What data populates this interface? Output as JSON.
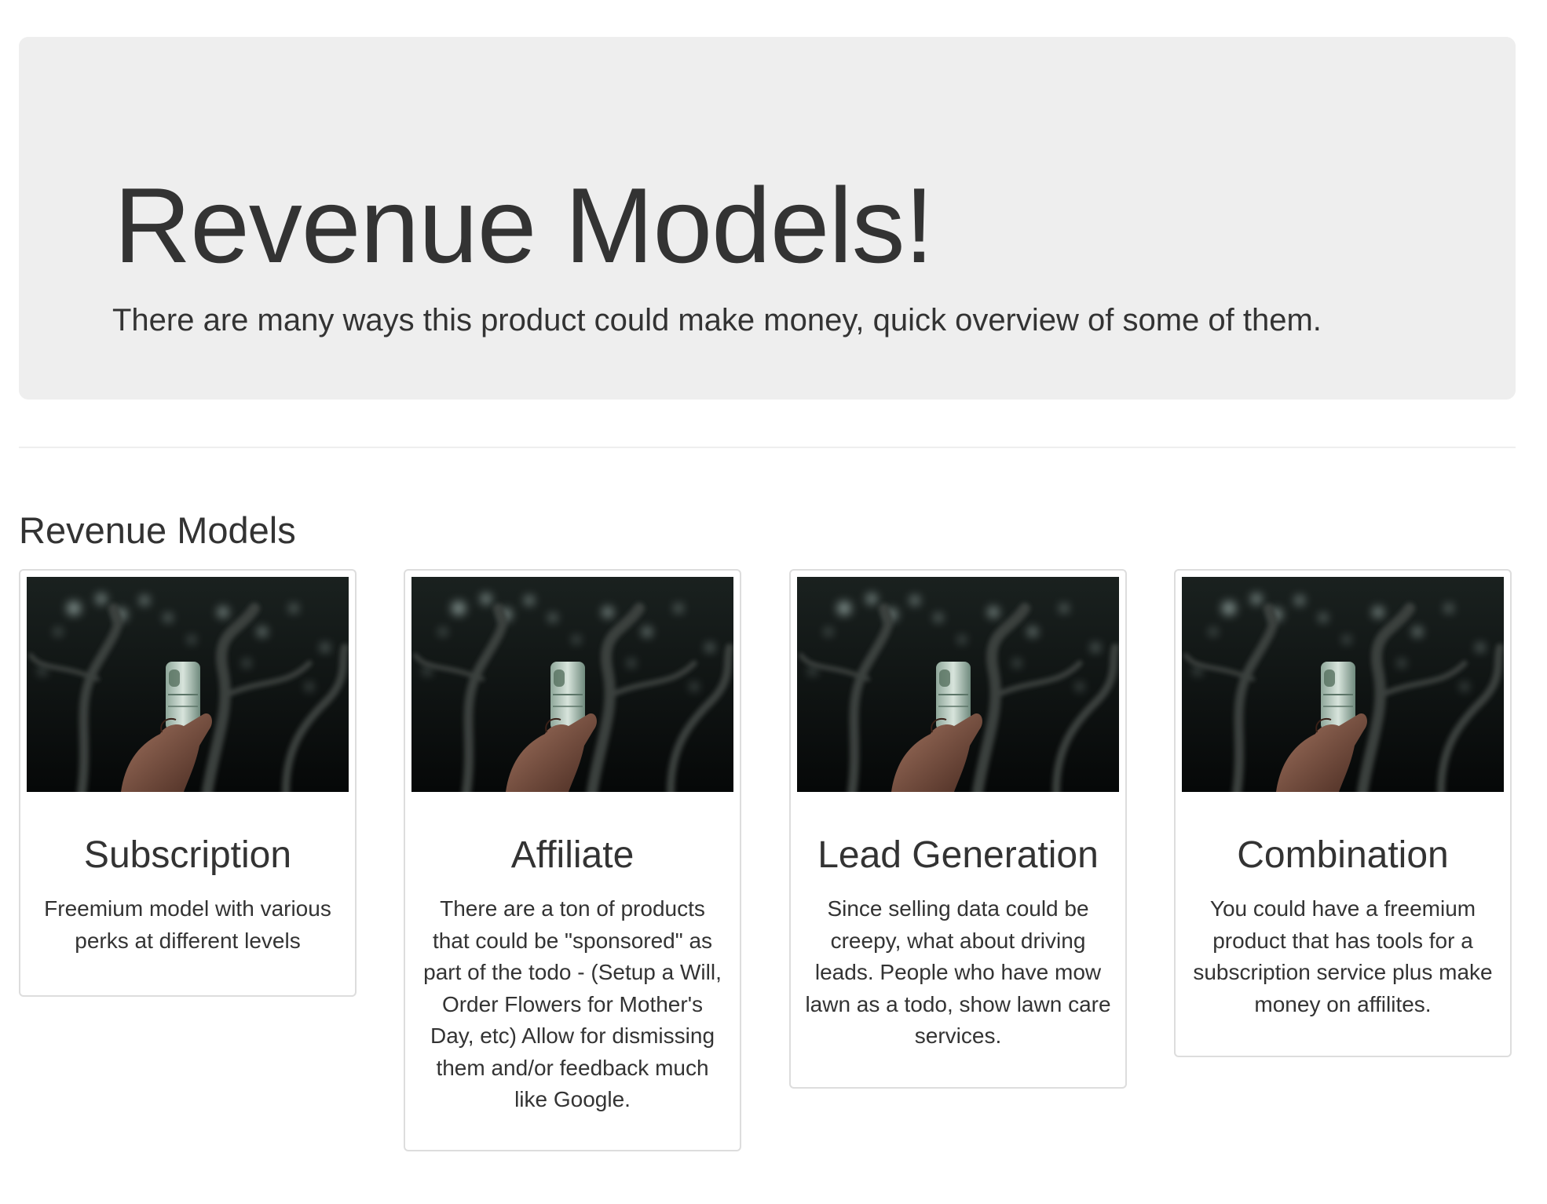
{
  "hero": {
    "title": "Revenue Models!",
    "subtitle": "There are many ways this product could make money, quick overview of some of them."
  },
  "section": {
    "title": "Revenue Models"
  },
  "cards": [
    {
      "title": "Subscription",
      "text": "Freemium model with various perks at different levels",
      "image": "money-photo"
    },
    {
      "title": "Affiliate",
      "text": "There are a ton of products that could be \"sponsored\" as part of the todo - (Setup a Will, Order Flowers for Mother's Day, etc) Allow for dismissing them and/or feedback much like Google.",
      "image": "money-photo"
    },
    {
      "title": "Lead Generation",
      "text": "Since selling data could be creepy, what about driving leads. People who have mow lawn as a todo, show lawn care services.",
      "image": "money-photo"
    },
    {
      "title": "Combination",
      "text": "You could have a freemium product that has tools for a subscription service plus make money on affilites.",
      "image": "money-photo"
    }
  ]
}
